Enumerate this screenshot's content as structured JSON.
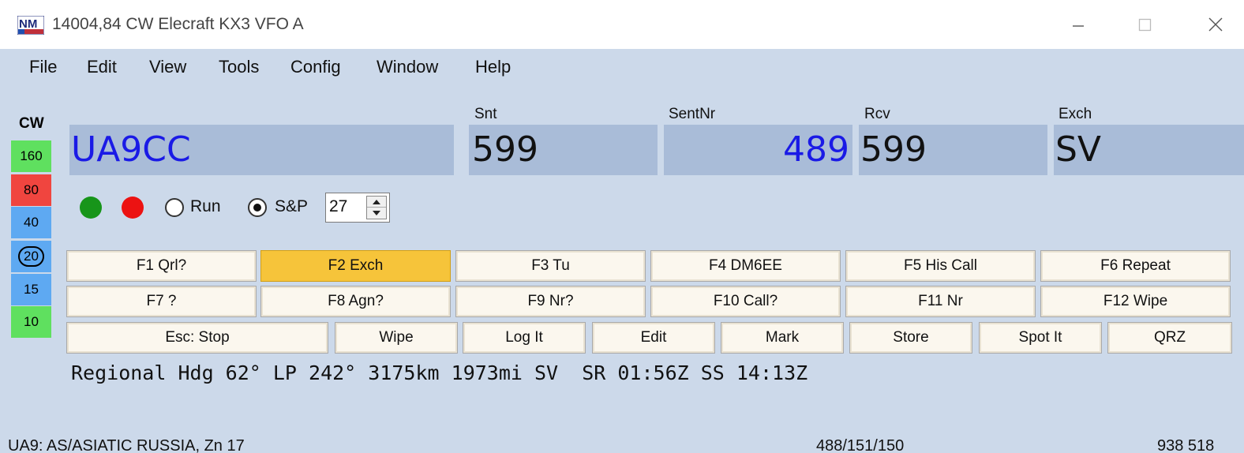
{
  "window": {
    "title": "14004,84 CW Elecraft KX3 VFO A",
    "minimize_icon": "minimize-icon",
    "maximize_icon": "maximize-icon",
    "close_icon": "close-icon"
  },
  "menu": [
    "File",
    "Edit",
    "View",
    "Tools",
    "Config",
    "Window",
    "Help"
  ],
  "mode": "CW",
  "bands": [
    {
      "label": "160",
      "color": "#5fe05f",
      "selected": false
    },
    {
      "label": "80",
      "color": "#f0453f",
      "selected": false
    },
    {
      "label": "40",
      "color": "#5ea9f2",
      "selected": false
    },
    {
      "label": "20",
      "color": "#5ea9f2",
      "selected": true
    },
    {
      "label": "15",
      "color": "#5ea9f2",
      "selected": false
    },
    {
      "label": "10",
      "color": "#5fe05f",
      "selected": false
    }
  ],
  "entry": {
    "call": {
      "value": "UA9CC",
      "color": "#1a1ae6"
    },
    "checkmark_icon": "checkmark-icon",
    "snt": {
      "label": "Snt",
      "value": "599"
    },
    "sentnr": {
      "label": "SentNr",
      "value": "489",
      "color": "#1a1ae6"
    },
    "rcv": {
      "label": "Rcv",
      "value": "599"
    },
    "exch": {
      "label": "Exch",
      "value": "SV"
    }
  },
  "indicators": {
    "led_green": "#17951a",
    "led_red": "#ec1212",
    "run_label": "Run",
    "sp_label": "S&P",
    "selected_mode": "S&P",
    "spin_value": "27"
  },
  "fkeys_row1": [
    {
      "label": "F1 Qrl?",
      "active": false
    },
    {
      "label": "F2 Exch",
      "active": true
    },
    {
      "label": "F3 Tu",
      "active": false
    },
    {
      "label": "F4 DM6EE",
      "active": false
    },
    {
      "label": "F5 His Call",
      "active": false
    },
    {
      "label": "F6 Repeat",
      "active": false
    }
  ],
  "fkeys_row2": [
    {
      "label": "F7 ?"
    },
    {
      "label": "F8 Agn?"
    },
    {
      "label": "F9 Nr?"
    },
    {
      "label": "F10 Call?"
    },
    {
      "label": "F11 Nr"
    },
    {
      "label": "F12 Wipe"
    }
  ],
  "action_buttons": [
    {
      "label": "Esc: Stop"
    },
    {
      "label": "Wipe"
    },
    {
      "label": "Log It"
    },
    {
      "label": "Edit"
    },
    {
      "label": "Mark"
    },
    {
      "label": "Store"
    },
    {
      "label": "Spot It"
    },
    {
      "label": "QRZ"
    }
  ],
  "info_line": "Regional Hdg 62° LP 242° 3175km 1973mi SV  SR 01:56Z SS 14:13Z",
  "status": {
    "left": "UA9: AS/ASIATIC RUSSIA, Zn 17",
    "mid": "488/151/150",
    "right": "938 518"
  }
}
